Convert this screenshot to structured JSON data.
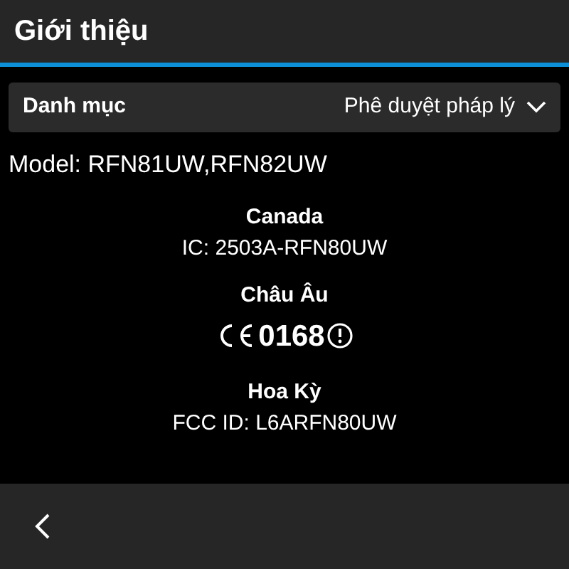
{
  "title_bar": {
    "title": "Giới thiệu"
  },
  "category": {
    "label": "Danh mục",
    "value": "Phê duyệt pháp lý"
  },
  "model": "Model: RFN81UW,RFN82UW",
  "regions": [
    {
      "kind": "text",
      "name": "Canada",
      "value": "IC: 2503A-RFN80UW"
    },
    {
      "kind": "ce_mark",
      "name": "Châu Âu",
      "value": "0168"
    },
    {
      "kind": "text",
      "name": "Hoa Kỳ",
      "value": "FCC ID: L6ARFN80UW"
    }
  ]
}
